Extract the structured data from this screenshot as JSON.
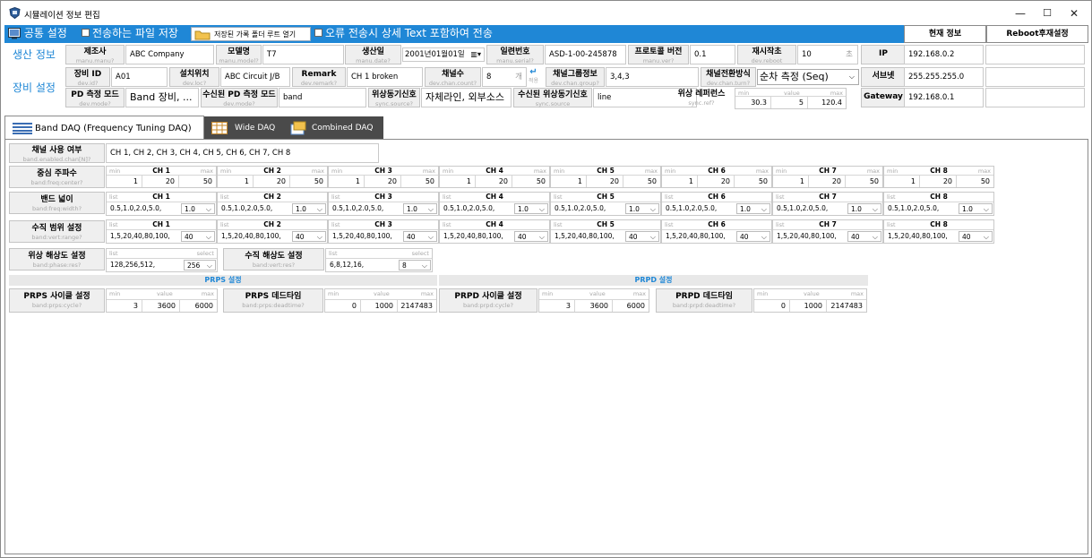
{
  "window": {
    "title": "시뮬레이션 정보 편집",
    "min": "—",
    "max": "☐",
    "close": "✕"
  },
  "toolbar": {
    "common": "공통 설정",
    "save_chk": "전송하는 파일 저장",
    "open_folder": "저장된 가록 폴더 루트 열기",
    "error_chk": "오류 전송시 상세 Text 포함하여 전송",
    "current_info": "현재 정보",
    "reboot": "Reboot후재설정"
  },
  "sections": {
    "production": "생산 정보",
    "device": "장비 설정"
  },
  "production": {
    "maker": {
      "label": "제조사",
      "sub": "manu.manu?",
      "value": "ABC Company"
    },
    "model": {
      "label": "모델명",
      "sub": "manu.model?",
      "value": "T7"
    },
    "date": {
      "label": "생산일",
      "sub": "manu.date?",
      "value": "2001년01월01일"
    },
    "serial": {
      "label": "일련번호",
      "sub": "manu.serial?",
      "value": "ASD-1-00-245878"
    },
    "proto": {
      "label": "프로토콜 버전",
      "sub": "manu.ver?",
      "value": "0.1"
    },
    "reboot": {
      "label": "재시작초",
      "sub": "dev.reboot",
      "value": "10",
      "unit": "초"
    }
  },
  "device": {
    "id": {
      "label": "장비 ID",
      "sub": "dev.id?",
      "value": "A01"
    },
    "loc": {
      "label": "설치위치",
      "sub": "dev.loc?",
      "value": "ABC Circuit J/B"
    },
    "remark": {
      "label": "Remark",
      "sub": "dev.remark?",
      "value": "CH 1 broken"
    },
    "chcount": {
      "label": "채널수",
      "sub": "dev.chan.count?",
      "value": "8",
      "unit": "개",
      "apply": "↵",
      "apply_sub": "적용"
    },
    "chgroup": {
      "label": "채널그룹정보",
      "sub": "dev.chan.group?",
      "value": "3,4,3"
    },
    "chturn": {
      "label": "채널전환방식",
      "sub": "dev.chan.turn?",
      "value": "순차 측정 (Seq)"
    },
    "pdmode": {
      "label": "PD 측정 모드",
      "sub": "dev.mode?",
      "value": "Band 장비, ..."
    },
    "recvmode": {
      "label": "수신된 PD 측정 모드",
      "sub": "dev.mode?",
      "value": "band"
    },
    "sync": {
      "label": "위상동기신호",
      "sub": "sync.source?",
      "value": "자체라인, 외부소스"
    },
    "recvsync": {
      "label": "수신된 위상동기신호",
      "sub": "sync.source",
      "value": "line"
    },
    "syncref": {
      "label": "위상 레퍼런스",
      "sub": "sync.ref?",
      "min": "30.3",
      "value": "5",
      "max": "120.4"
    }
  },
  "net": {
    "ip": {
      "label": "IP",
      "value": "192.168.0.2"
    },
    "subnet": {
      "label": "서브넷",
      "value": "255.255.255.0"
    },
    "gateway": {
      "label": "Gateway",
      "value": "192.168.0.1"
    }
  },
  "common": {
    "min": "min",
    "value": "value",
    "max": "max",
    "list": "list",
    "select": "select"
  },
  "tabs": [
    "Band DAQ (Frequency Tuning DAQ)",
    "Wide DAQ",
    "Combined DAQ"
  ],
  "band": {
    "enable": {
      "label": "채널 사용 여부",
      "sub": "band.enabled.chan[N]?",
      "value": "CH 1, CH 2, CH 3, CH 4, CH 5, CH 6, CH 7, CH 8"
    },
    "channels": [
      "CH 1",
      "CH 2",
      "CH 3",
      "CH 4",
      "CH 5",
      "CH 6",
      "CH 7",
      "CH 8"
    ],
    "center": {
      "label": "중심 주파수",
      "sub": "band:freq:center?",
      "min": "1",
      "value": "20",
      "max": "50"
    },
    "width": {
      "label": "밴드 넓이",
      "sub": "band:freq:width?",
      "list": "0.5,1.0,2.0,5.0,",
      "sel": "1.0"
    },
    "range": {
      "label": "수직 범위 설정",
      "sub": "band:vert:range?",
      "list": "1,5,20,40,80,100,",
      "sel": "40"
    },
    "phase": {
      "label": "위상 해상도 설정",
      "sub": "band:phase:res?",
      "list": "128,256,512,",
      "sel": "256"
    },
    "vres": {
      "label": "수직 해상도 설정",
      "sub": "band:vert:res?",
      "list": "6,8,12,16,",
      "sel": "8"
    },
    "prps_title": "PRPS 설정",
    "prpd_title": "PRPD 설정",
    "prps_cycle": {
      "label": "PRPS 사이클 설정",
      "sub": "band:prps:cycle?",
      "min": "3",
      "value": "3600",
      "max": "6000"
    },
    "prps_dead": {
      "label": "PRPS 데드타임",
      "sub": "band:prps:deadtime?",
      "min": "0",
      "value": "1000",
      "max": "2147483"
    },
    "prpd_cycle": {
      "label": "PRPD 사이클 설정",
      "sub": "band:prpd:cycle?",
      "min": "3",
      "value": "3600",
      "max": "6000"
    },
    "prpd_dead": {
      "label": "PRPD 데드타임",
      "sub": "band:prpd:deadtime?",
      "min": "0",
      "value": "1000",
      "max": "2147483"
    }
  },
  "colors": {
    "accent": "#1f87d6"
  }
}
